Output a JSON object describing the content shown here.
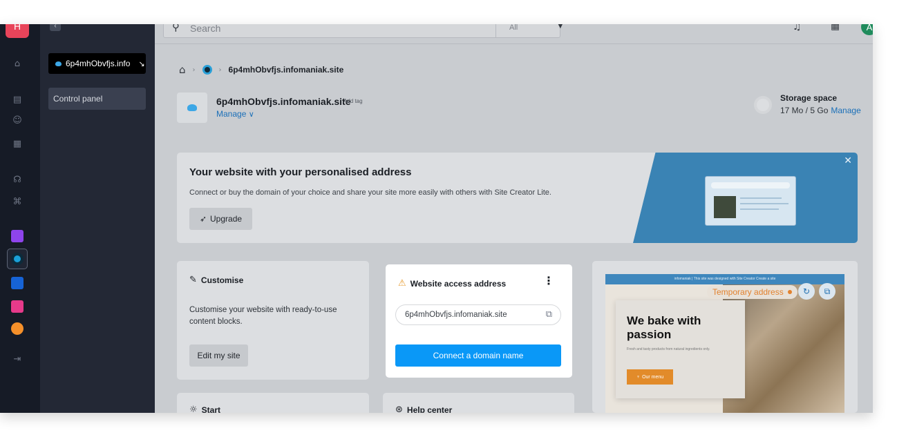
{
  "rail": {
    "brand_letter": "H",
    "colors": {
      "brand": "#e8445a",
      "kchat": "#8e44ec",
      "site": "#1aa0d8",
      "drive": "#1663d6",
      "mail": "#e63a8a",
      "swiss": "#f5902a"
    }
  },
  "sidebar": {
    "collapse_icon": "‹",
    "site_selector": "6p4mhObvfjs.info",
    "site_selector_arrow": "↘",
    "items": [
      {
        "label": "Control panel"
      }
    ]
  },
  "topbar": {
    "search_placeholder": "Search",
    "filter_value": "All",
    "avatar_letter": "A"
  },
  "breadcrumb": {
    "current": "6p4mhObvfjs.infomaniak.site"
  },
  "site": {
    "name": "6p4mhObvfjs.infomaniak.site",
    "add_tag": "Add tag",
    "manage": "Manage"
  },
  "storage": {
    "label": "Storage space",
    "value": "17 Mo / 5 Go",
    "manage": "Manage"
  },
  "banner": {
    "title": "Your website with your personalised address",
    "description": "Connect or buy the domain of your choice and share your site more easily with others with Site Creator Lite.",
    "upgrade": "Upgrade"
  },
  "customise": {
    "title": "Customise",
    "description": "Customise your website with ready-to-use content blocks.",
    "button": "Edit my site"
  },
  "access": {
    "title": "Website access address",
    "address": "6p4mhObvfjs.infomaniak.site",
    "button": "Connect a domain name"
  },
  "preview": {
    "strip": "infomaniak | This site was designed with Site Creator   Create a site",
    "temporary": "Temporary address",
    "heading": "We bake with passion",
    "subtext": "Fresh and tasty products from natural ingredients only.",
    "menu_button": "Our menu"
  },
  "start": {
    "title": "Start"
  },
  "help": {
    "title": "Help center"
  }
}
